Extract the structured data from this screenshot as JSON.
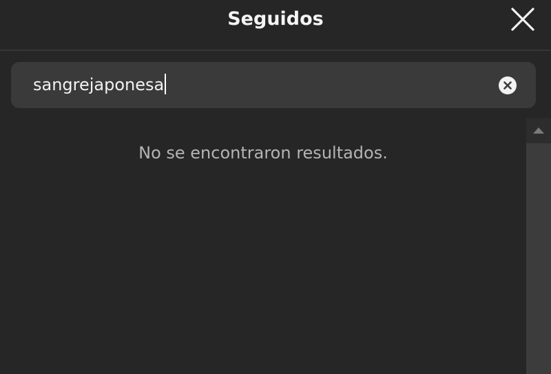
{
  "dialog": {
    "title": "Seguidos",
    "close_icon": "close-icon"
  },
  "search": {
    "value": "sangrejaponesa",
    "clear_icon": "clear-circle-icon"
  },
  "results": {
    "empty_message": "No se encontraron resultados."
  },
  "scrollbar": {
    "up_icon": "scroll-up-arrow-icon"
  },
  "colors": {
    "background": "#262626",
    "search_background": "#3a3a3a",
    "text_primary": "#f5f5f5",
    "text_secondary": "#b4b4b4"
  }
}
